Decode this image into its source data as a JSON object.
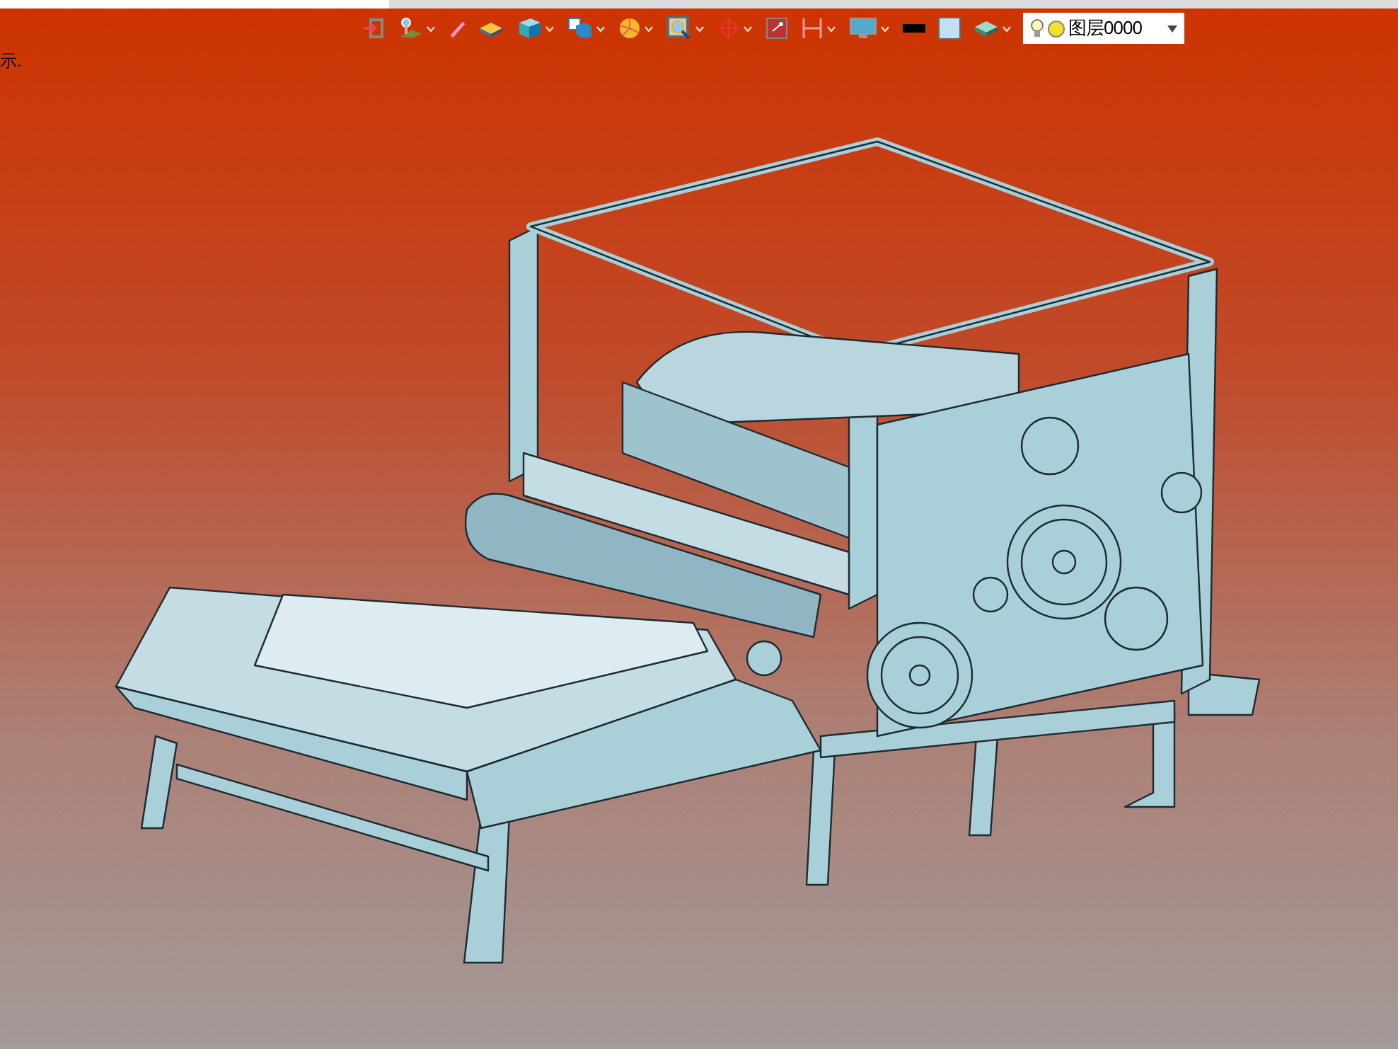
{
  "viewport_hint": "示.",
  "toolbar": {
    "items": [
      {
        "dropdown": false
      },
      {
        "dropdown": true
      },
      {
        "dropdown": false
      },
      {
        "dropdown": false
      },
      {
        "dropdown": true
      },
      {
        "dropdown": true
      },
      {
        "dropdown": true
      },
      {
        "dropdown": true
      },
      {
        "dropdown": true
      },
      {
        "dropdown": false
      },
      {
        "dropdown": true
      },
      {
        "dropdown": true
      },
      {
        "dropdown": false
      },
      {
        "dropdown": false
      },
      {
        "dropdown": true
      }
    ],
    "layer_select": {
      "value": "图层0000",
      "light_on": true
    }
  }
}
